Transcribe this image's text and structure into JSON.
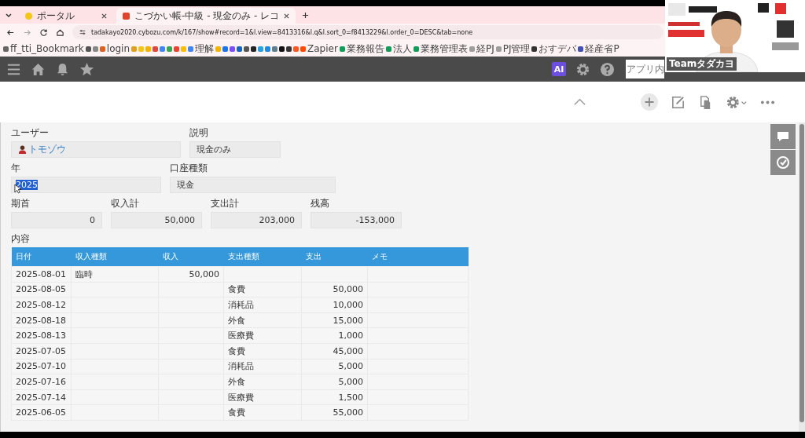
{
  "browser": {
    "tabs": [
      {
        "title": "ポータル",
        "selected": false
      },
      {
        "title": "こづかい帳-中級 - 現金のみ - レコ",
        "selected": true
      }
    ],
    "url": "tadakayo2020.cybozu.com/k/167/show#record=1&l.view=8413316&l.q&l.sort_0=f8413229&l.order_0=DESC&tab=none",
    "bookmarks": [
      {
        "label": "ff_tti_Bookmark",
        "color": "#666666"
      },
      {
        "color": "#555555"
      },
      {
        "color": "#888888"
      },
      {
        "label": "login",
        "color": "#e06020"
      },
      {
        "color": "#e0a020"
      },
      {
        "color": "#f5c518"
      },
      {
        "color": "#f5b400"
      },
      {
        "color": "#e2463c"
      },
      {
        "color": "#4285f4"
      },
      {
        "color": "#34a853"
      },
      {
        "color": "#ea4335"
      },
      {
        "color": "#fbbc04"
      },
      {
        "label": "理解",
        "color": "#4285f4"
      },
      {
        "color": "#f4b400"
      },
      {
        "color": "#1a73e8"
      },
      {
        "color": "#7c4dff"
      },
      {
        "color": "#1565c0"
      },
      {
        "color": "#555555"
      },
      {
        "color": "#222222"
      },
      {
        "color": "#2aa0e0"
      },
      {
        "color": "#1e88e5"
      },
      {
        "color": "#607d8b"
      },
      {
        "color": "#111111"
      },
      {
        "color": "#333333"
      },
      {
        "color": "#ff5722"
      },
      {
        "label": "Zapier",
        "color": "#ff4a00"
      },
      {
        "label": "業務報告",
        "color": "#0f9d58"
      },
      {
        "label": "法人",
        "color": "#0f9d58"
      },
      {
        "label": "業務管理表",
        "color": "#0f9d58"
      },
      {
        "label": "経PJ",
        "color": "#9e9e9e"
      },
      {
        "label": "PJ管理",
        "color": "#9e9e9e"
      },
      {
        "label": "おすデバ",
        "color": "#333333"
      },
      {
        "label": "経産省P",
        "color": "#3f51b5"
      }
    ]
  },
  "app": {
    "ai_badge": "AI",
    "search": {
      "placeholder": "アプリ内"
    }
  },
  "video_overlay": {
    "kind": "picture",
    "name_tag": "Teamタダカヨ"
  },
  "record": {
    "user": {
      "label": "ユーザー",
      "value": "トモゾウ"
    },
    "description": {
      "label": "説明",
      "value": "現金のみ"
    },
    "year": {
      "label": "年",
      "value": "2025",
      "text_selected": true
    },
    "account_type": {
      "label": "口座種類",
      "value": "現金"
    },
    "totals": [
      {
        "label": "期首",
        "value": "0"
      },
      {
        "label": "収入計",
        "value": "50,000"
      },
      {
        "label": "支出計",
        "value": "203,000"
      },
      {
        "label": "残高",
        "value": "-153,000"
      }
    ],
    "table": {
      "label": "内容",
      "columns": [
        "日付",
        "収入種類",
        "収入",
        "支出種類",
        "支出",
        "メモ"
      ],
      "rows": [
        {
          "date": "2025-08-01",
          "income_type": "臨時",
          "income": "50,000"
        },
        {
          "date": "2025-08-05",
          "expense_type": "食費",
          "expense": "50,000"
        },
        {
          "date": "2025-08-12",
          "expense_type": "消耗品",
          "expense": "10,000"
        },
        {
          "date": "2025-08-18",
          "expense_type": "外食",
          "expense": "15,000"
        },
        {
          "date": "2025-08-13",
          "expense_type": "医療費",
          "expense": "1,000"
        },
        {
          "date": "2025-07-05",
          "expense_type": "食費",
          "expense": "45,000"
        },
        {
          "date": "2025-07-10",
          "expense_type": "消耗品",
          "expense": "5,000"
        },
        {
          "date": "2025-07-16",
          "expense_type": "外食",
          "expense": "5,000"
        },
        {
          "date": "2025-07-14",
          "expense_type": "医療費",
          "expense": "1,500"
        },
        {
          "date": "2025-06-05",
          "expense_type": "食費",
          "expense": "55,000"
        }
      ]
    }
  }
}
